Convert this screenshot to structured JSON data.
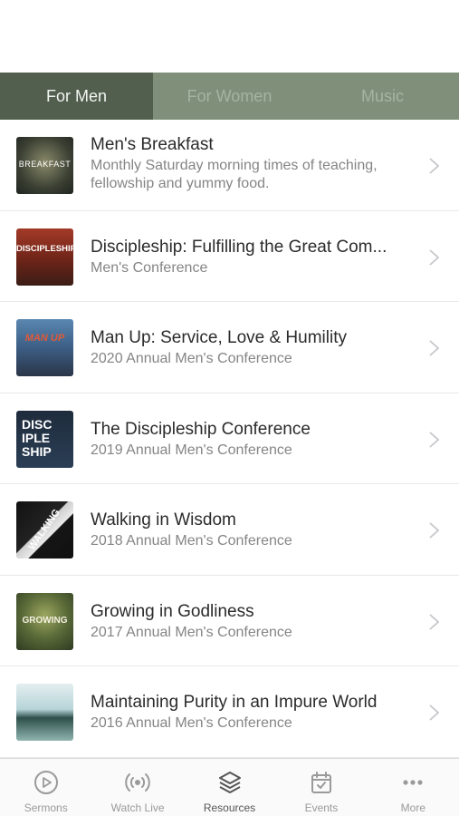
{
  "status_bar": {
    "text": ""
  },
  "segment_tabs": [
    {
      "label": "For Men",
      "active": true
    },
    {
      "label": "For Women",
      "active": false
    },
    {
      "label": "Music",
      "active": false
    }
  ],
  "items": [
    {
      "title": "Men's Breakfast",
      "subtitle": "Monthly Saturday morning times of teaching, fellowship and yummy food.",
      "thumb_text": "BREAKFAST"
    },
    {
      "title": "Discipleship: Fulfilling the Great Com...",
      "subtitle": "Men's Conference",
      "thumb_text": "DISCIPLESHIP"
    },
    {
      "title": "Man Up: Service, Love & Humility",
      "subtitle": "2020 Annual Men's Conference",
      "thumb_text": "MAN UP"
    },
    {
      "title": "The Discipleship Conference",
      "subtitle": "2019 Annual Men's Conference",
      "thumb_text": "DISC IPLE SHIP"
    },
    {
      "title": "Walking in Wisdom",
      "subtitle": "2018 Annual Men's Conference",
      "thumb_text": "WALKING"
    },
    {
      "title": "Growing in Godliness",
      "subtitle": "2017 Annual Men's Conference",
      "thumb_text": "GROWING"
    },
    {
      "title": "Maintaining Purity in an Impure World",
      "subtitle": "2016 Annual Men's Conference",
      "thumb_text": ""
    }
  ],
  "tabbar": [
    {
      "label": "Sermons",
      "icon": "play-circle-icon",
      "active": false
    },
    {
      "label": "Watch Live",
      "icon": "broadcast-icon",
      "active": false
    },
    {
      "label": "Resources",
      "icon": "layers-icon",
      "active": true
    },
    {
      "label": "Events",
      "icon": "calendar-icon",
      "active": false
    },
    {
      "label": "More",
      "icon": "more-dots-icon",
      "active": false
    }
  ],
  "colors": {
    "tab_active_bg": "#525e4e",
    "tab_inactive_bg": "#7f8f7a",
    "tabbar_active": "#555555",
    "tabbar_inactive": "#9a9a9a"
  }
}
